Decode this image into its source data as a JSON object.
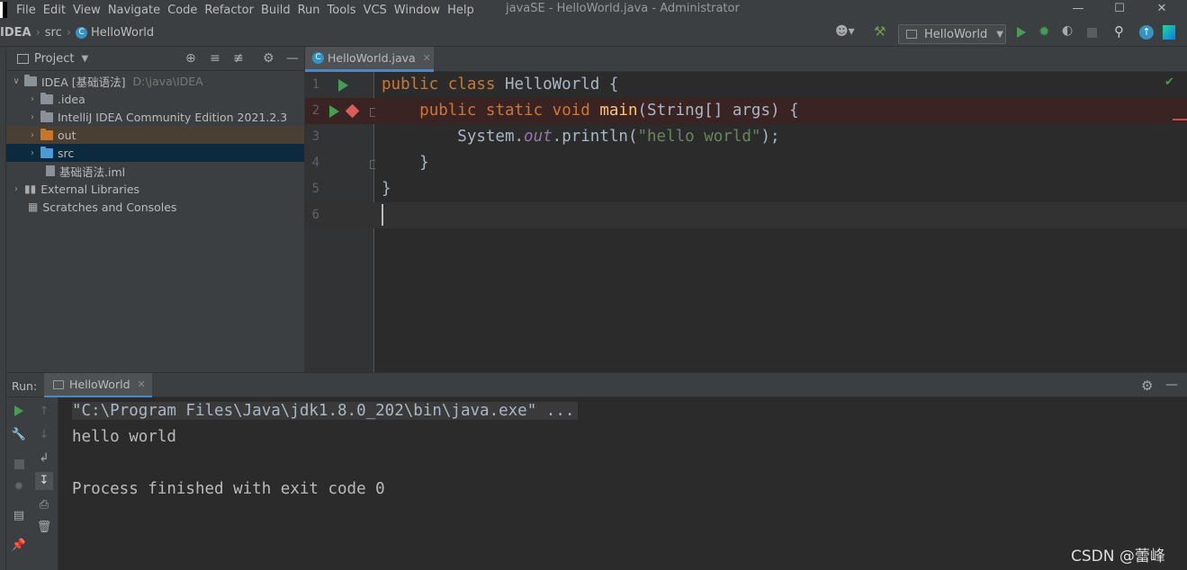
{
  "menubar": {
    "items": [
      "File",
      "Edit",
      "View",
      "Navigate",
      "Code",
      "Refactor",
      "Build",
      "Run",
      "Tools",
      "VCS",
      "Window",
      "Help"
    ],
    "window_title": "javaSE - HelloWorld.java - Administrator"
  },
  "breadcrumb": {
    "project": "IDEA",
    "folder": "src",
    "file": "HelloWorld"
  },
  "toolbar": {
    "run_config": "HelloWorld"
  },
  "project_panel": {
    "title": "Project",
    "tree": [
      {
        "label": "IDEA [基础语法]",
        "path": "D:\\java\\IDEA"
      },
      {
        "label": ".idea"
      },
      {
        "label": "IntelliJ IDEA Community Edition 2021.2.3"
      },
      {
        "label": "out"
      },
      {
        "label": "src"
      },
      {
        "label": "基础语法.iml"
      },
      {
        "label": "External Libraries"
      },
      {
        "label": "Scratches and Consoles"
      }
    ]
  },
  "editor": {
    "tab_label": "HelloWorld.java",
    "line_numbers": [
      "1",
      "2",
      "3",
      "4",
      "5",
      "6"
    ],
    "code": {
      "l1_kw": "public class ",
      "l1_rest": "HelloWorld {",
      "l2_indent": "    ",
      "l2_kw": "public static void ",
      "l2_fn": "main",
      "l2_rest": "(String[] args) {",
      "l3_pre": "        System.",
      "l3_field": "out",
      "l3_call": ".println(",
      "l3_str": "\"hello world\"",
      "l3_end": ");",
      "l4": "    }",
      "l5": "}"
    }
  },
  "run_panel": {
    "label": "Run:",
    "tab_label": "HelloWorld",
    "console": {
      "command": "\"C:\\Program Files\\Java\\jdk1.8.0_202\\bin\\java.exe\" ...",
      "output": "hello world",
      "exit": "Process finished with exit code 0"
    }
  },
  "watermark": "CSDN @蕾峰",
  "colors": {
    "background": "#2b2b2b",
    "panel": "#3c3f41",
    "keyword": "#cc7832",
    "string": "#6a8759",
    "function": "#ffc66d",
    "field": "#9876aa",
    "run_green": "#499c54",
    "breakpoint_red": "#db5c5c"
  }
}
